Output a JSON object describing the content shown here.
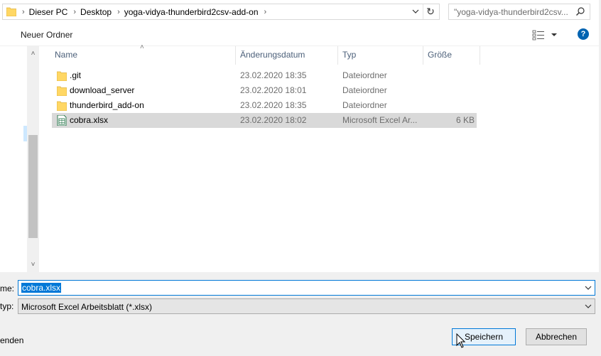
{
  "address_bar": {
    "breadcrumbs": [
      "Dieser PC",
      "Desktop",
      "yoga-vidya-thunderbird2csv-add-on"
    ],
    "search_placeholder": "\"yoga-vidya-thunderbird2csv..."
  },
  "toolbar": {
    "new_folder_label": "Neuer Ordner",
    "help_label": "?"
  },
  "columns": {
    "name": "Name",
    "date": "Änderungsdatum",
    "type": "Typ",
    "size": "Größe"
  },
  "files": [
    {
      "name": ".git",
      "date": "23.02.2020 18:35",
      "type": "Dateiordner",
      "size": "",
      "icon": "folder-icon"
    },
    {
      "name": "download_server",
      "date": "23.02.2020 18:01",
      "type": "Dateiordner",
      "size": "",
      "icon": "folder-icon"
    },
    {
      "name": "thunderbird_add-on",
      "date": "23.02.2020 18:35",
      "type": "Dateiordner",
      "size": "",
      "icon": "folder-icon"
    },
    {
      "name": "cobra.xlsx",
      "date": "23.02.2020 18:02",
      "type": "Microsoft Excel Ar...",
      "size": "6 KB",
      "icon": "excel-file-icon",
      "selected": true
    }
  ],
  "form": {
    "filename_label": "me:",
    "filename_value": "cobra.xlsx",
    "filetype_label": "typ:",
    "filetype_value": "Microsoft Excel Arbeitsblatt (*.xlsx)",
    "hide_folders_label": "enden"
  },
  "buttons": {
    "save": "Speichern",
    "cancel": "Abbrechen"
  },
  "colors": {
    "accent": "#0078d7",
    "folder": "#ffd764",
    "selection": "#d9d9d9",
    "help": "#0063b1"
  }
}
